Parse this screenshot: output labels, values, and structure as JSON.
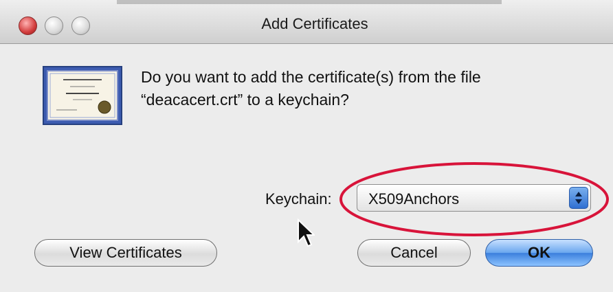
{
  "window": {
    "title": "Add Certificates",
    "buttons": [
      "close",
      "minimize",
      "zoom"
    ]
  },
  "message": {
    "line1": "Do you want to add the certificate(s) from the file",
    "line2": "“deacacert.crt” to a keychain?"
  },
  "icon": "certificate-icon",
  "keychain": {
    "label": "Keychain:",
    "selected": "X509Anchors"
  },
  "buttons": {
    "view_certificates": "View Certificates",
    "cancel": "Cancel",
    "ok": "OK"
  },
  "colors": {
    "highlight": "#d8143a",
    "default_button": "#3b7fdc"
  }
}
